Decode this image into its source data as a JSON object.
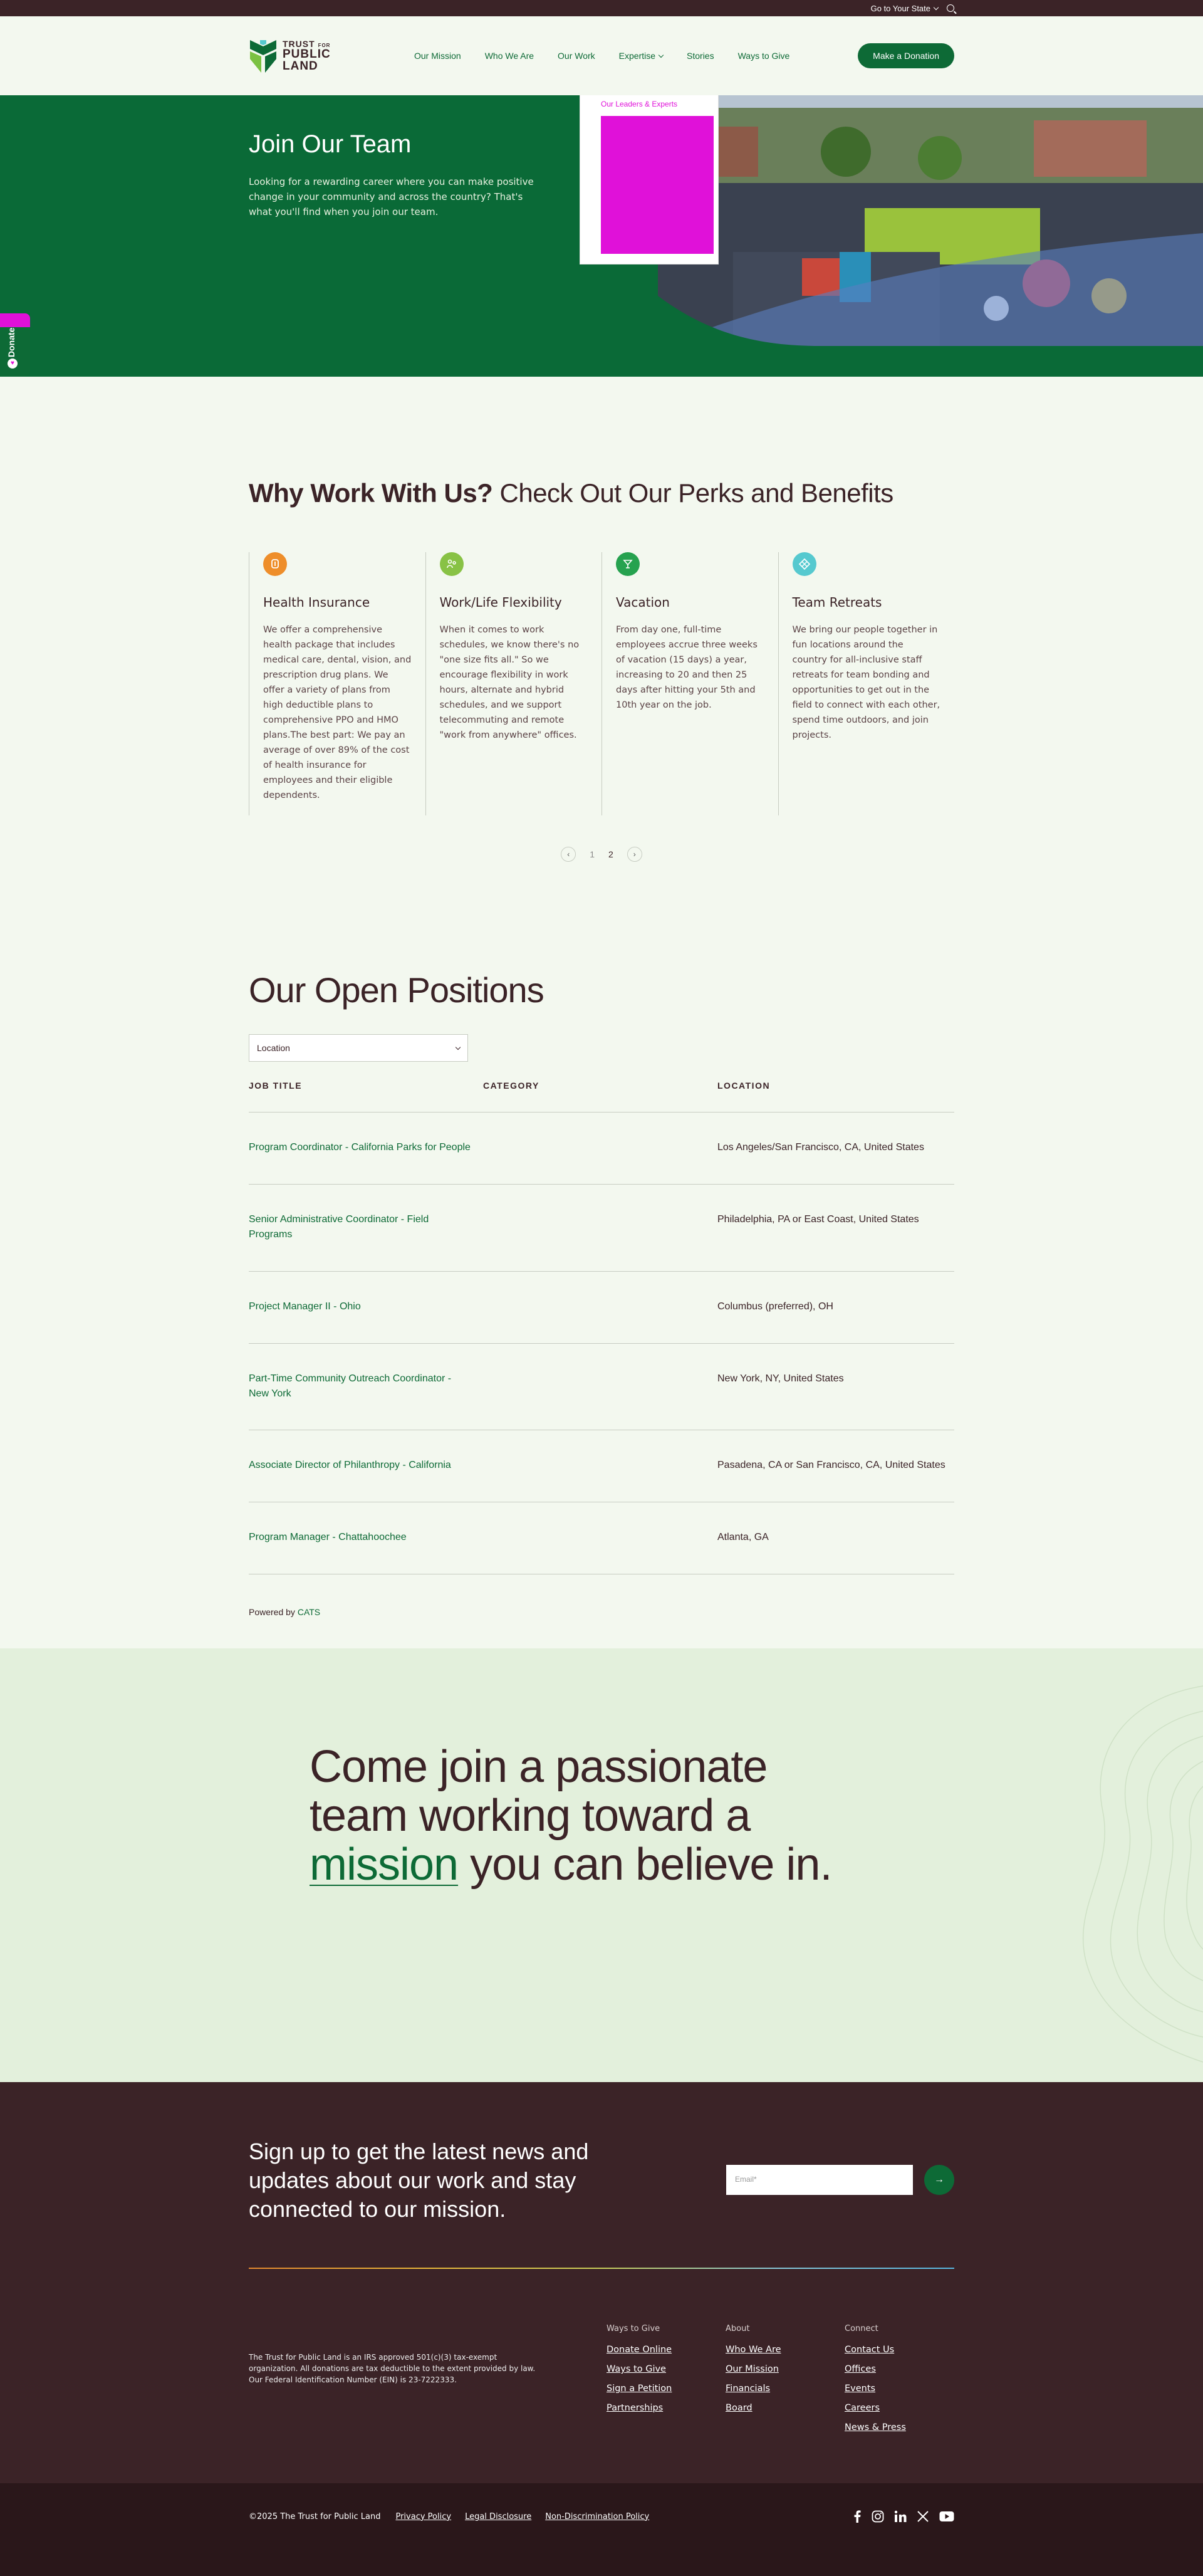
{
  "utility": {
    "state_label": "Go to Your State"
  },
  "logo": {
    "line1": "TRUST",
    "line1_small": "FOR",
    "line2": "PUBLIC",
    "line3": "LAND"
  },
  "nav": {
    "items": [
      "Our Mission",
      "Who We Are",
      "Our Work",
      "Expertise",
      "Stories",
      "Ways to Give"
    ],
    "donate": "Make a Donation"
  },
  "dropdown": {
    "items": [
      "Our Leaders & Experts",
      "",
      "",
      "",
      "",
      "",
      ""
    ]
  },
  "hero": {
    "title": "Join Our Team",
    "text": "Looking for a rewarding career where you can make positive change in your community and across the country? That's what you'll find when you join our team."
  },
  "side_tab": {
    "label": "Donate"
  },
  "perks": {
    "title_bold": "Why Work With Us?",
    "title_rest": " Check Out Our Perks and Benefits",
    "cards": [
      {
        "icon": "shield-icon",
        "color": "#ee8e2a",
        "title": "Health Insurance",
        "text": "We offer a comprehensive health package that includes medical care, dental, vision, and prescription drug plans. We offer a variety of plans from high deductible plans to comprehensive PPO and HMO plans.The best part: We pay an average of over 89% of the cost of health insurance for employees and their eligible dependents."
      },
      {
        "icon": "people-icon",
        "color": "#88c245",
        "title": "Work/Life Flexibility",
        "text": "When it comes to work schedules, we know there's no \"one size fits all.\" So we encourage flexibility in work hours, alternate and hybrid schedules, and we support telecommuting and remote \"work from anywhere\" offices."
      },
      {
        "icon": "drink-icon",
        "color": "#26a24f",
        "title": "Vacation",
        "text": "From day one, full-time employees accrue three weeks of vacation (15 days) a year, increasing to 20 and then 25 days after hitting your 5th and 10th year on the job."
      },
      {
        "icon": "retreat-icon",
        "color": "#56c9cf",
        "title": "Team Retreats",
        "text": "We bring our people together in fun locations around the country for all-inclusive staff retreats for team bonding and opportunities to get out in the field to connect with each other, spend time outdoors, and join projects."
      }
    ],
    "pager": {
      "page1": "1",
      "page2": "2"
    }
  },
  "positions": {
    "title": "Our Open Positions",
    "location_placeholder": "Location",
    "headers": {
      "job": "JOB TITLE",
      "category": "CATEGORY",
      "location": "LOCATION"
    },
    "rows": [
      {
        "title": "Program Coordinator - California Parks for People",
        "category": "",
        "location": "Los Angeles/San Francisco, CA, United States"
      },
      {
        "title": "Senior Administrative Coordinator - Field Programs",
        "category": "",
        "location": "Philadelphia, PA or East Coast, United States"
      },
      {
        "title": "Project Manager II - Ohio",
        "category": "",
        "location": "Columbus (preferred), OH"
      },
      {
        "title": "Part-Time Community Outreach Coordinator - New York",
        "category": "",
        "location": "New York, NY, United States"
      },
      {
        "title": "Associate Director of Philanthropy - California",
        "category": "",
        "location": "Pasadena, CA or San Francisco, CA, United States"
      },
      {
        "title": "Program Manager - Chattahoochee",
        "category": "",
        "location": "Atlanta, GA"
      }
    ],
    "powered_by": "Powered by ",
    "powered_link": "CATS"
  },
  "banner": {
    "line1": "Come join a passionate",
    "line2": "team working toward a",
    "emph": "mission",
    "line3_rest": " you can believe in."
  },
  "footer": {
    "signup": "Sign up to get the latest news and updates about our work and stay connected to our mission.",
    "email_placeholder": "Email*",
    "legal": "The Trust for Public Land is an IRS approved 501(c)(3) tax-exempt organization. All donations are tax deductible to the extent provided by law. Our Federal Identification Number (EIN) is 23-7222333.",
    "cols": [
      {
        "heading": "Ways to Give",
        "links": [
          "Donate Online",
          "Ways to Give",
          "Sign a Petition",
          "Partnerships"
        ]
      },
      {
        "heading": "About",
        "links": [
          "Who We Are",
          "Our Mission",
          "Financials",
          "Board"
        ]
      },
      {
        "heading": "Connect",
        "links": [
          "Contact Us",
          "Offices",
          "Events",
          "Careers",
          "News & Press"
        ]
      }
    ],
    "copyright": "©2025 The Trust for Public Land",
    "bottom_links": [
      "Privacy Policy",
      "Legal Disclosure",
      "Non-Discrimination Policy"
    ]
  }
}
